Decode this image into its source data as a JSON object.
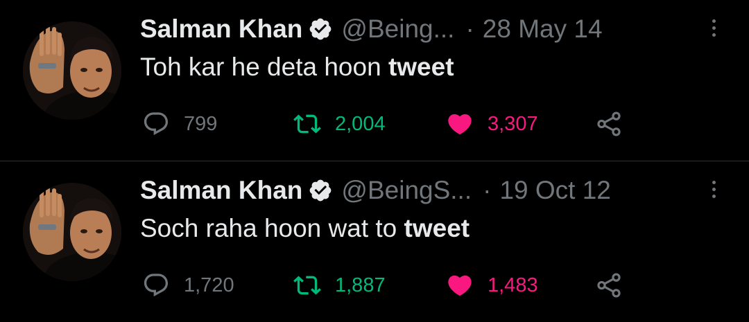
{
  "tweets": [
    {
      "author": "Salman Khan",
      "handle": "@Being...",
      "separator": "·",
      "date": "28 May 14",
      "text_plain": "Toh kar he deta hoon ",
      "text_bold": "tweet",
      "replies": "799",
      "retweets": "2,004",
      "likes": "3,307"
    },
    {
      "author": "Salman Khan",
      "handle": "@BeingS...",
      "separator": "·",
      "date": "19 Oct 12",
      "text_plain": "Soch raha hoon wat to ",
      "text_bold": "tweet",
      "replies": "1,720",
      "retweets": "1,887",
      "likes": "1,483"
    }
  ],
  "icons": {
    "reply": "reply-icon",
    "retweet": "retweet-icon",
    "like": "heart-icon",
    "share": "share-icon",
    "verified": "verified-badge-icon",
    "more": "more-options-icon"
  },
  "colors": {
    "background": "#000000",
    "text": "#e7e9ea",
    "muted": "#71767b",
    "retweet": "#00ba7c",
    "like": "#f91880"
  }
}
